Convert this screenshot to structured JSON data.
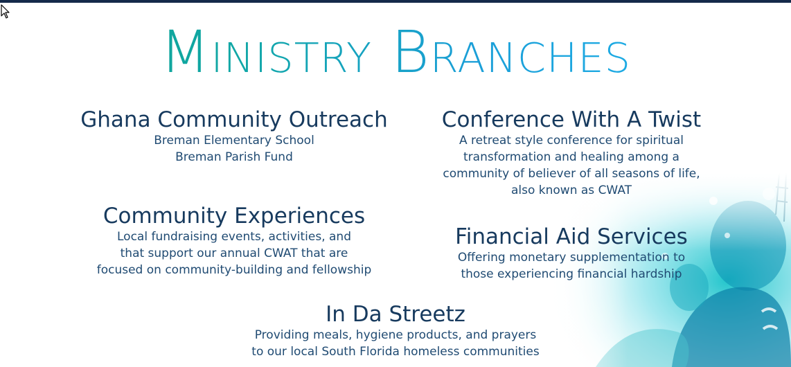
{
  "page": {
    "title": "Ministry Branches"
  },
  "branches": [
    {
      "heading": "Ghana Community Outreach",
      "lines": [
        "Breman Elementary School",
        "Breman Parish Fund"
      ]
    },
    {
      "heading": "Conference With A Twist",
      "lines": [
        "A retreat style conference for spiritual",
        "transformation and healing among a",
        "community of believer of all seasons of life,",
        "also known as CWAT"
      ]
    },
    {
      "heading": "Community Experiences",
      "lines": [
        "Local fundraising events, activities, and",
        "that support our annual CWAT that are",
        "focused on community-building and fellowship"
      ]
    },
    {
      "heading": "Financial Aid Services",
      "lines": [
        "Offering monetary supplementation to",
        "those experiencing financial hardship"
      ]
    },
    {
      "heading": "In Da Streetz",
      "lines": [
        "Providing meals, hygiene products, and prayers",
        "to our local South Florida homeless communities"
      ]
    }
  ],
  "colors": {
    "top_bar": "#142a4a",
    "heading_text": "#173a5e",
    "title_gradient_start": "#0ea38a",
    "title_gradient_end": "#20b6ef"
  },
  "icons": {
    "cursor": "mouse-pointer-icon"
  }
}
